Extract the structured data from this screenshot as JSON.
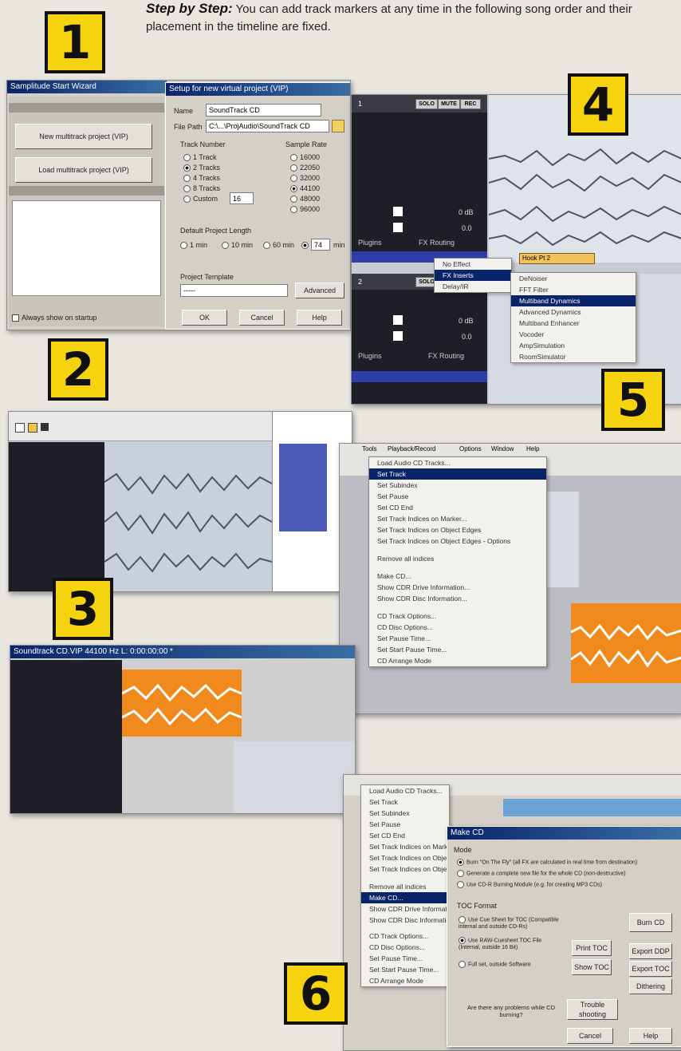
{
  "header": {
    "title": "Step by Step:",
    "text": "You can add track markers at any time in the following song order and their placement in the timeline are fixed."
  },
  "callouts": [
    "1",
    "2",
    "3",
    "4",
    "5",
    "6"
  ],
  "shot1": {
    "wizard_title": "Samplitude Start Wizard",
    "new_button": "New multitrack project (VIP)",
    "load_button": "Load multitrack project (VIP)",
    "show_checkbox": "Always show on startup",
    "dialog_title": "Setup for new virtual project (VIP)",
    "name_label": "Name",
    "name_value": "SoundTrack CD",
    "path_label": "File Path",
    "path_value": "C:\\...\\ProjAudio\\SoundTrack CD",
    "track_number_label": "Track Number",
    "track_options": [
      "1 Track",
      "2 Tracks",
      "4 Tracks",
      "8 Tracks",
      "Custom"
    ],
    "custom_value": "16",
    "sample_rate_label": "Sample Rate",
    "sample_rates": [
      "16000",
      "22050",
      "32000",
      "44100",
      "48000",
      "96000"
    ],
    "length_label": "Default Project Length",
    "length_options": [
      "1 min",
      "10 min",
      "60 min"
    ],
    "length_value": "74",
    "length_unit": "min",
    "template_label": "Project Template",
    "template_value": "-----",
    "advanced_button": "Advanced",
    "ok_button": "OK",
    "cancel_button": "Cancel",
    "help_button": "Help"
  },
  "shot4": {
    "track1": "1",
    "track2": "2",
    "solo": "SOLO",
    "mute": "MUTE",
    "rec": "REC",
    "db1": "0 dB",
    "db2": "0.0",
    "plugins": "Plugins",
    "fx_routing": "FX Routing",
    "clip_label": "Hook Pt 2",
    "menu_main": [
      "No Effect",
      "FX Inserts",
      "Delay/IR"
    ],
    "menu_fx": [
      "DeNoiser",
      "FFT Filter",
      "Multiband Dynamics",
      "Advanced Dynamics",
      "Multiband Enhancer",
      "Vocoder",
      "AmpSimulation",
      "RoomSimulator"
    ]
  },
  "shot5": {
    "menubar": [
      "Tools",
      "Playback/Record",
      "Options",
      "Window",
      "Help"
    ],
    "menu_items": [
      "Load Audio CD Tracks...",
      "Set Track",
      "Set Subindex",
      "Set Pause",
      "Set CD End",
      "Set Track Indices on Marker...",
      "Set Track Indices on Object Edges",
      "Set Track Indices on Object Edges - Options",
      "Remove all indices",
      "Make CD...",
      "Show CDR Drive Information...",
      "Show CDR Disc Information...",
      "CD Track Options...",
      "CD Disc Options...",
      "Set Pause Time...",
      "Set Start Pause Time...",
      "CD Arrange Mode"
    ]
  },
  "shot6": {
    "dialog_title": "Make CD",
    "mode_label": "Mode",
    "mode_options": [
      "Burn \"On The Fly\" (all FX are calculated in real time from destination)",
      "Generate a complete new file for the whole CD (non-destructive)",
      "Use CD-R Burning Module (e.g. for creating MP3 CDs)"
    ],
    "toc_label": "TOC Format",
    "toc_options": [
      "Use Cue Sheet for TOC (Compatible internal and outside CD-Rs)",
      "Use RAW-Cuesheet TOC File (Internal, outside 16 Bit)",
      "Full set, outside Software"
    ],
    "burn_button": "Burn CD",
    "export_ddp": "Export DDP",
    "export_toc": "Export TOC",
    "print_toc": "Print TOC",
    "show_toc": "Show TOC",
    "dithering": "Dithering",
    "problem_text": "Are there any problems while CD burning?",
    "troubleshoot_button": "Trouble shooting",
    "cancel_button": "Cancel",
    "help_button": "Help",
    "menu_items": [
      "Load Audio CD Tracks...",
      "Set Track",
      "Set Subindex",
      "Set Pause",
      "Set CD End",
      "Set Track Indices on Marker",
      "Set Track Indices on Object",
      "Set Track Indices on Object",
      "Remove all indices",
      "Make CD...",
      "Show CDR Drive Information",
      "Show CDR Disc Information",
      "CD Track Options...",
      "CD Disc Options...",
      "Set Pause Time...",
      "Set Start Pause Time...",
      "CD Arrange Mode"
    ]
  },
  "shot3": {
    "title": "Soundtrack CD.VIP  44100 Hz  L: 0:00:00:00 *"
  },
  "colors": {
    "callout": "#f5d40f",
    "win_title": "#0a246a",
    "orange_object": "#f08a1c"
  }
}
